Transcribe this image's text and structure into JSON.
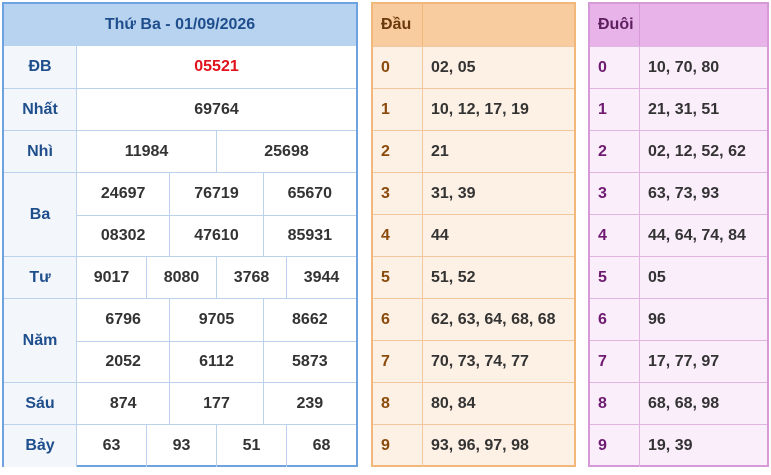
{
  "header": {
    "title": "Thứ Ba - 01/09/2026"
  },
  "prizes": [
    {
      "label": "ĐB",
      "lines": [
        [
          "05521"
        ]
      ],
      "highlight": true
    },
    {
      "label": "Nhất",
      "lines": [
        [
          "69764"
        ]
      ]
    },
    {
      "label": "Nhì",
      "lines": [
        [
          "11984",
          "25698"
        ]
      ]
    },
    {
      "label": "Ba",
      "lines": [
        [
          "24697",
          "76719",
          "65670"
        ],
        [
          "08302",
          "47610",
          "85931"
        ]
      ]
    },
    {
      "label": "Tư",
      "lines": [
        [
          "9017",
          "8080",
          "3768",
          "3944"
        ]
      ]
    },
    {
      "label": "Năm",
      "lines": [
        [
          "6796",
          "9705",
          "8662"
        ],
        [
          "2052",
          "6112",
          "5873"
        ]
      ]
    },
    {
      "label": "Sáu",
      "lines": [
        [
          "874",
          "177",
          "239"
        ]
      ]
    },
    {
      "label": "Bảy",
      "lines": [
        [
          "63",
          "93",
          "51",
          "68"
        ]
      ]
    }
  ],
  "dau": {
    "title": "Đầu",
    "rows": [
      {
        "key": "0",
        "values": "02, 05"
      },
      {
        "key": "1",
        "values": "10, 12, 17, 19"
      },
      {
        "key": "2",
        "values": "21"
      },
      {
        "key": "3",
        "values": "31, 39"
      },
      {
        "key": "4",
        "values": "44"
      },
      {
        "key": "5",
        "values": "51, 52"
      },
      {
        "key": "6",
        "values": "62, 63, 64, 68, 68"
      },
      {
        "key": "7",
        "values": "70, 73, 74, 77"
      },
      {
        "key": "8",
        "values": "80, 84"
      },
      {
        "key": "9",
        "values": "93, 96, 97, 98"
      }
    ]
  },
  "duoi": {
    "title": "Đuôi",
    "rows": [
      {
        "key": "0",
        "values": "10, 70, 80"
      },
      {
        "key": "1",
        "values": "21, 31, 51"
      },
      {
        "key": "2",
        "values": "02, 12, 52, 62"
      },
      {
        "key": "3",
        "values": "63, 73, 93"
      },
      {
        "key": "4",
        "values": "44, 64, 74, 84"
      },
      {
        "key": "5",
        "values": "05"
      },
      {
        "key": "6",
        "values": "96"
      },
      {
        "key": "7",
        "values": "17, 77, 97"
      },
      {
        "key": "8",
        "values": "68, 68, 98"
      },
      {
        "key": "9",
        "values": "19, 39"
      }
    ]
  },
  "colors": {
    "prize_border": "#6fa3df",
    "prize_header": "#b8d3f0",
    "special_prize": "#e0121c",
    "dau_header": "#f9cc9f",
    "duoi_header": "#e7b3e8"
  }
}
